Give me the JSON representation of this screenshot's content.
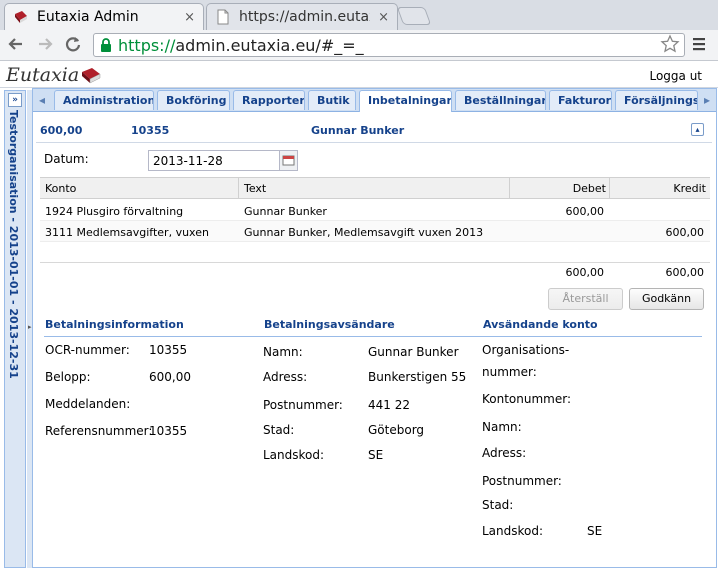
{
  "browser": {
    "tabs": [
      {
        "title": "Eutaxia Admin",
        "active": true
      },
      {
        "title": "https://admin.eutaxia.e",
        "active": false
      }
    ],
    "close_glyph": "×",
    "url_scheme": "https://",
    "url_rest": "admin.eutaxia.eu/#_=_",
    "icons": {
      "back": "arrow-left-icon",
      "forward": "arrow-right-icon",
      "reload": "reload-icon",
      "lock": "lock-icon",
      "star": "star-icon",
      "menu": "menu-icon"
    },
    "colors": {
      "secure": "#008f3a"
    }
  },
  "app": {
    "logo_text": "Eutaxia",
    "logout_label": "Logga ut",
    "org_label": "Testorganisation - 2013-01-01 - 2013-12-31",
    "colors": {
      "accent": "#15428b",
      "border": "#99bbe8"
    }
  },
  "tabs": [
    "Administration",
    "Bokföring",
    "Rapporter",
    "Butik",
    "Inbetalningar",
    "Beställningar",
    "Fakturor",
    "Försäljningsr"
  ],
  "active_tab": "Inbetalningar",
  "panel": {
    "amount": "600,00",
    "ocr": "10355",
    "payer": "Gunnar Bunker"
  },
  "form": {
    "datum_label": "Datum:",
    "datum_value": "2013-11-28"
  },
  "grid": {
    "columns": [
      "Konto",
      "Text",
      "Debet",
      "Kredit"
    ],
    "rows": [
      {
        "konto": "1924 Plusgiro förvaltning",
        "text": "Gunnar Bunker",
        "debet": "600,00",
        "kredit": ""
      },
      {
        "konto": "3111 Medlemsavgifter, vuxen",
        "text": "Gunnar Bunker, Medlemsavgift vuxen 2013",
        "debet": "",
        "kredit": "600,00"
      }
    ],
    "sum_debet": "600,00",
    "sum_kredit": "600,00"
  },
  "buttons": {
    "reset": "Återställ",
    "approve": "Godkänn"
  },
  "betalningsinfo": {
    "title": "Betalningsinformation",
    "ocr_label": "OCR-nummer:",
    "ocr_value": "10355",
    "belopp_label": "Belopp:",
    "belopp_value": "600,00",
    "meddelanden_label": "Meddelanden:",
    "referens_label": "Referensnummer:",
    "referens_value": "10355"
  },
  "avsandare": {
    "title": "Betalningsavsändare",
    "namn_label": "Namn:",
    "namn_value": "Gunnar Bunker",
    "adress_label": "Adress:",
    "adress_value": "Bunkerstigen 55",
    "postnummer_label": "Postnummer:",
    "postnummer_value": "441 22",
    "stad_label": "Stad:",
    "stad_value": "Göteborg",
    "landskod_label": "Landskod:",
    "landskod_value": "SE"
  },
  "konto": {
    "title": "Avsändande konto",
    "org_label_1": "Organisations-",
    "org_label_2": "nummer:",
    "kontonummer_label": "Kontonummer:",
    "namn_label": "Namn:",
    "adress_label": "Adress:",
    "postnummer_label": "Postnummer:",
    "stad_label": "Stad:",
    "landskod_label": "Landskod:",
    "landskod_value": "SE"
  }
}
